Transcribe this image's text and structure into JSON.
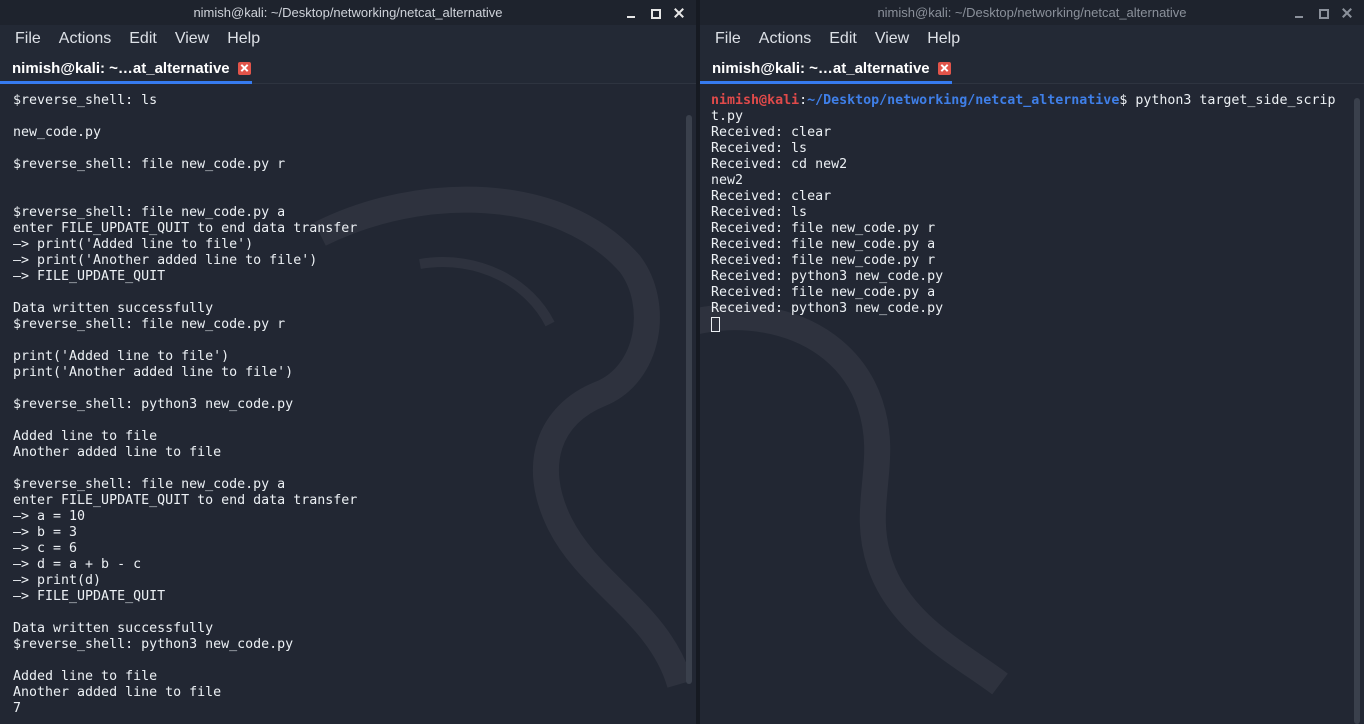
{
  "left_window": {
    "title": "nimish@kali: ~/Desktop/networking/netcat_alternative",
    "menu": [
      "File",
      "Actions",
      "Edit",
      "View",
      "Help"
    ],
    "tab_label": "nimish@kali: ~…at_alternative",
    "terminal_lines": [
      "$reverse_shell: ls",
      "",
      "new_code.py",
      "",
      "$reverse_shell: file new_code.py r",
      "",
      "",
      "$reverse_shell: file new_code.py a",
      "enter FILE_UPDATE_QUIT to end data transfer",
      "—> print('Added line to file')",
      "—> print('Another added line to file')",
      "—> FILE_UPDATE_QUIT",
      "",
      "Data written successfully",
      "$reverse_shell: file new_code.py r",
      "",
      "print('Added line to file')",
      "print('Another added line to file')",
      "",
      "$reverse_shell: python3 new_code.py",
      "",
      "Added line to file",
      "Another added line to file",
      "",
      "$reverse_shell: file new_code.py a",
      "enter FILE_UPDATE_QUIT to end data transfer",
      "—> a = 10",
      "—> b = 3",
      "—> c = 6",
      "—> d = a + b - c",
      "—> print(d)",
      "—> FILE_UPDATE_QUIT",
      "",
      "Data written successfully",
      "$reverse_shell: python3 new_code.py",
      "",
      "Added line to file",
      "Another added line to file",
      "7"
    ]
  },
  "right_window": {
    "title": "nimish@kali: ~/Desktop/networking/netcat_alternative",
    "menu": [
      "File",
      "Actions",
      "Edit",
      "View",
      "Help"
    ],
    "tab_label": "nimish@kali: ~…at_alternative",
    "prompt": {
      "user": "nimish",
      "at": "@",
      "host": "kali",
      "sep": ":",
      "path": "~/Desktop/networking/netcat_alternative",
      "dollar": "$ ",
      "command_line1": "python3 target_side_scrip",
      "command_line2": "t.py"
    },
    "terminal_lines": [
      "Received: clear",
      "Received: ls",
      "Received: cd new2",
      "new2",
      "Received: clear",
      "Received: ls",
      "Received: file new_code.py r",
      "Received: file new_code.py a",
      "Received: file new_code.py r",
      "Received: python3 new_code.py",
      "Received: file new_code.py a",
      "Received: python3 new_code.py"
    ]
  }
}
